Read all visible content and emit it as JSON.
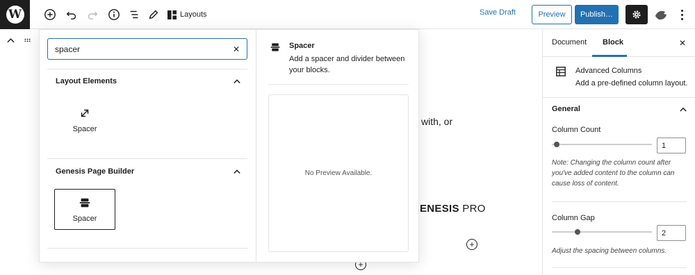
{
  "topbar": {
    "layouts_label": "Layouts",
    "save_draft": "Save Draft",
    "preview": "Preview",
    "publish": "Publish…"
  },
  "editor": {
    "text_fragment": "with, or",
    "brand_bold": "GENESIS",
    "brand_rest": " PRO"
  },
  "inserter": {
    "search_value": "spacer",
    "clear_glyph": "✕",
    "panels": [
      {
        "title": "Layout Elements",
        "items": [
          {
            "label": "Spacer",
            "icon": "resize-arrows-icon"
          }
        ]
      },
      {
        "title": "Genesis Page Builder",
        "items": [
          {
            "label": "Spacer",
            "icon": "spacer-block-icon"
          }
        ]
      }
    ],
    "preview": {
      "title": "Spacer",
      "description": "Add a spacer and divider between your blocks.",
      "no_preview": "No Preview Available."
    }
  },
  "sidebar": {
    "tabs": [
      "Document",
      "Block"
    ],
    "active_tab": "Block",
    "close_glyph": "✕",
    "block_card": {
      "title": "Advanced Columns",
      "description": "Add a pre-defined column layout."
    },
    "general": {
      "title": "General",
      "column_count_label": "Column Count",
      "column_count_value": "1",
      "column_count_fraction": 0.0,
      "column_count_help": "Note: Changing the column count after you've added content to the column can cause loss of content.",
      "column_gap_label": "Column Gap",
      "column_gap_value": "2",
      "column_gap_fraction": 0.22,
      "column_gap_help": "Adjust the spacing between columns."
    }
  },
  "colors": {
    "accent": "#2271b1",
    "dark": "#1e1e1e",
    "border": "#e2e4e7"
  }
}
